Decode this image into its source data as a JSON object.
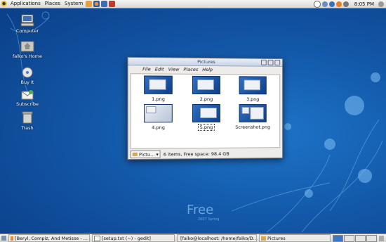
{
  "top_panel": {
    "menus": [
      "Applications",
      "Places",
      "System"
    ],
    "clock": "8:05 PM"
  },
  "desktop": {
    "icons": [
      {
        "label": "Computer"
      },
      {
        "label": "falko's Home"
      },
      {
        "label": "Buy It"
      },
      {
        "label": "Subscribe"
      },
      {
        "label": "Trash"
      }
    ],
    "wallpaper_text": "Free",
    "wallpaper_subtext": "2007 Spring"
  },
  "window": {
    "title": "Pictures",
    "menu": [
      "File",
      "Edit",
      "View",
      "Places",
      "Help"
    ],
    "files": [
      "1.png",
      "2.png",
      "3.png",
      "4.png",
      "5.png",
      "Screenshot.png"
    ],
    "location_combo": "Pictu...",
    "status": "6 items, Free space: 98.4 GB"
  },
  "bottom_panel": {
    "tasks": [
      "[Beryl, Compiz, And Metisse - ...",
      "[setup.txt (~) - gedit]",
      "[falko@localhost: /home/falko/D...",
      "Pictures"
    ]
  },
  "colors": {
    "desktop": "#1358a8",
    "panel": "#e4e3df",
    "window": "#edecea"
  }
}
